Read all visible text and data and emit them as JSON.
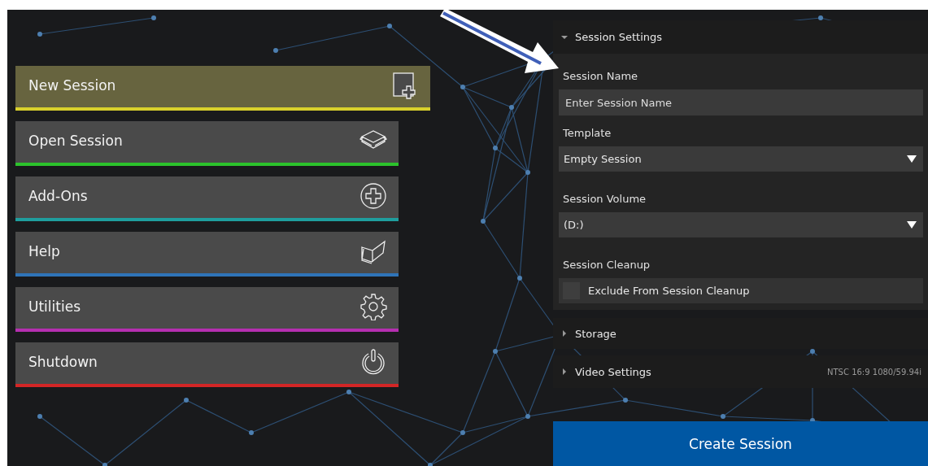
{
  "menu": [
    {
      "label": "New Session",
      "selected": true,
      "color": "#d9d12c"
    },
    {
      "label": "Open Session",
      "selected": false,
      "color": "#2cc22c"
    },
    {
      "label": "Add-Ons",
      "selected": false,
      "color": "#1f9e9e"
    },
    {
      "label": "Help",
      "selected": false,
      "color": "#2f74b8"
    },
    {
      "label": "Utilities",
      "selected": false,
      "color": "#b52fb0"
    },
    {
      "label": "Shutdown",
      "selected": false,
      "color": "#d32626"
    }
  ],
  "settings": {
    "title": "Session Settings",
    "expanded": true,
    "fields": [
      {
        "kind": "text",
        "label": "Session Name",
        "placeholder": "Enter Session Name"
      },
      {
        "kind": "select",
        "label": "Template",
        "value": "Empty Session"
      },
      {
        "kind": "select",
        "label": "Session Volume",
        "value": "(D:)"
      },
      {
        "kind": "checkbox",
        "label": "Session Cleanup",
        "option": "Exclude From Session Cleanup",
        "checked": false
      }
    ]
  },
  "sections": [
    {
      "title": "Storage",
      "expanded": false
    },
    {
      "title": "Video Settings",
      "expanded": false,
      "value": "NTSC 16:9 1080/59.94i"
    }
  ],
  "create_button": "Create Session"
}
